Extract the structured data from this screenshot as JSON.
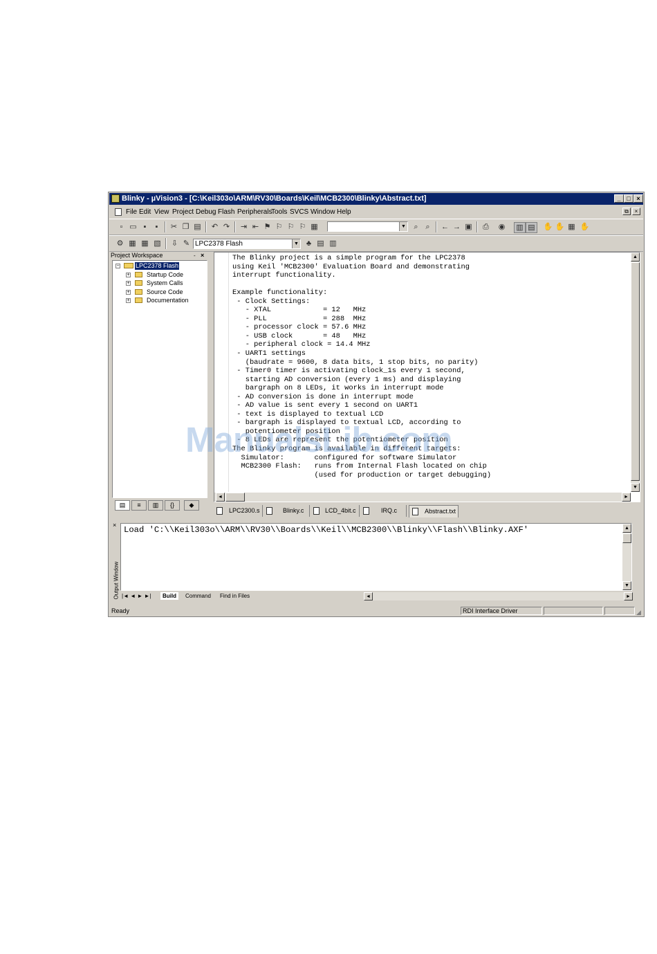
{
  "window": {
    "title": "Blinky  - µVision3 - [C:\\Keil303o\\ARM\\RV30\\Boards\\Keil\\MCB2300\\Blinky\\Abstract.txt]",
    "minimize": "_",
    "maximize": "□",
    "close": "×"
  },
  "menu": {
    "items": [
      "File",
      "Edit",
      "View",
      "Project",
      "Debug",
      "Flash",
      "Peripherals",
      "Tools",
      "SVCS",
      "Window",
      "Help"
    ],
    "mdi_restore": "⧉",
    "mdi_close": "×"
  },
  "toolbar2": {
    "target_select": "LPC2378 Flash"
  },
  "workspace": {
    "title": "Project Workspace",
    "root": "LPC2378 Flash",
    "groups": [
      "Startup Code",
      "System Calls",
      "Source Code",
      "Documentation"
    ]
  },
  "editor": {
    "lines": [
      "The Blinky project is a simple program for the LPC2378",
      "using Keil 'MCB2300' Evaluation Board and demonstrating",
      "interrupt functionality.",
      "",
      "Example functionality:",
      " - Clock Settings:",
      "   - XTAL            = 12   MHz",
      "   - PLL             = 288  MHz",
      "   - processor clock = 57.6 MHz",
      "   - USB clock       = 48   MHz",
      "   - peripheral clock = 14.4 MHz",
      " - UART1 settings",
      "   (baudrate = 9600, 8 data bits, 1 stop bits, no parity)",
      " - Timer0 timer is activating clock_1s every 1 second,",
      "   starting AD conversion (every 1 ms) and displaying",
      "   bargraph on 8 LEDs, it works in interrupt mode",
      " - AD conversion is done in interrupt mode",
      " - AD value is sent every 1 second on UART1",
      " - text is displayed to textual LCD",
      " - bargraph is displayed to textual LCD, according to",
      "   potentiometer position",
      " - 8 LEDs are represent the potentiometer position",
      "The Blinky program is available in different targets:",
      "  Simulator:       configured for software Simulator",
      "  MCB2300 Flash:   runs from Internal Flash located on chip",
      "                   (used for production or target debugging)"
    ]
  },
  "file_tabs": [
    "LPC2300.s",
    "Blinky.c",
    "LCD_4bit.c",
    "IRQ.c",
    "Abstract.txt"
  ],
  "output": {
    "side_label": "Output Window",
    "text": "Load 'C:\\\\Keil303o\\\\ARM\\\\RV30\\\\Boards\\\\Keil\\\\MCB2300\\\\Blinky\\\\Flash\\\\Blinky.AXF'",
    "tabs": [
      "Build",
      "Command",
      "Find in Files"
    ]
  },
  "status": {
    "left": "Ready",
    "driver": "RDI Interface Driver"
  },
  "watermark": "ManualsLib.com"
}
